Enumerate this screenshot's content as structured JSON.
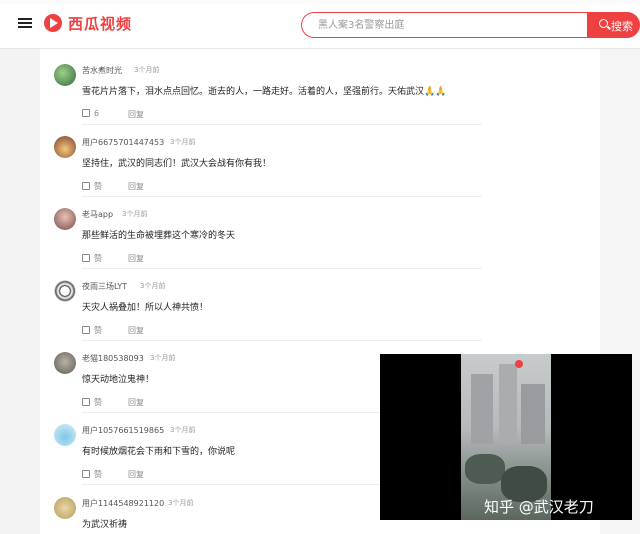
{
  "app": {
    "name": "西瓜视频",
    "brand_color": "#f04142"
  },
  "search": {
    "placeholder": "黑人案3名警察出庭",
    "button_label": "搜索"
  },
  "comments": [
    {
      "user": "苦水煮时光",
      "time": "3个月前",
      "text": "雪花片片落下，泪水点点回忆。逝去的人，一路走好。活着的人，坚强前行。天佑武汉🙏🙏",
      "likes": "6",
      "reply": "回复"
    },
    {
      "user": "用户6675701447453",
      "time": "3个月前",
      "text": "坚持住，武汉的同志们！武汉大会战有你有我！",
      "likes": "赞",
      "reply": "回复"
    },
    {
      "user": "老马app",
      "time": "3个月前",
      "text": "那些鲜活的生命被埋葬这个寒冷的冬天",
      "likes": "赞",
      "reply": "回复"
    },
    {
      "user": "夜雨三场LYT",
      "time": "3个月前",
      "text": "天灾人祸叠加！所以人神共愤！",
      "likes": "赞",
      "reply": "回复"
    },
    {
      "user": "老猫180538093",
      "time": "3个月前",
      "text": "惊天动地泣鬼神！",
      "likes": "赞",
      "reply": "回复"
    },
    {
      "user": "用户1057661519865",
      "time": "3个月前",
      "text": "有时候放烟花会下雨和下雪的，你说呢",
      "likes": "赞",
      "reply": "回复"
    },
    {
      "user": "用户1144548921120",
      "time": "3个月前",
      "text": "为武汉祈祷",
      "likes": "",
      "reply": ""
    }
  ],
  "video": {
    "watermark": "知乎 @武汉老刀"
  }
}
